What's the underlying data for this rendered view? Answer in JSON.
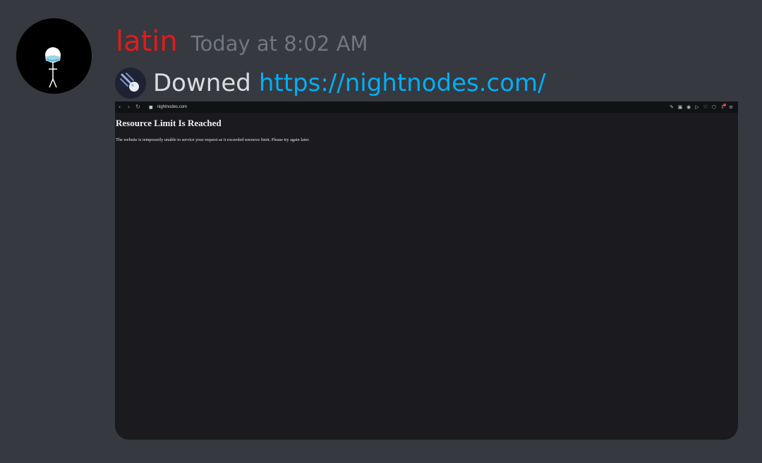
{
  "message": {
    "username": "latin",
    "timestamp": "Today at 8:02 AM",
    "text": "Downed",
    "link": "https://nightnodes.com/",
    "emoji": "meteor-emoji",
    "colors": {
      "username": "#e01b1b",
      "link": "#00aff4",
      "timestamp": "#72767d",
      "background": "#36393f"
    }
  },
  "attachment": {
    "browser": {
      "url": "nightnodes.com",
      "nav_icons": [
        "back-icon",
        "forward-icon",
        "reload-icon"
      ],
      "toolbar_icons": [
        "edit-icon",
        "camera-icon",
        "record-icon",
        "play-icon",
        "heart-icon",
        "cube-icon",
        "download-icon",
        "menu-icon"
      ]
    },
    "page": {
      "heading": "Resource Limit Is Reached",
      "body": "The website is temporarily unable to service your request as it exceeded resource limit. Please try again later."
    }
  }
}
